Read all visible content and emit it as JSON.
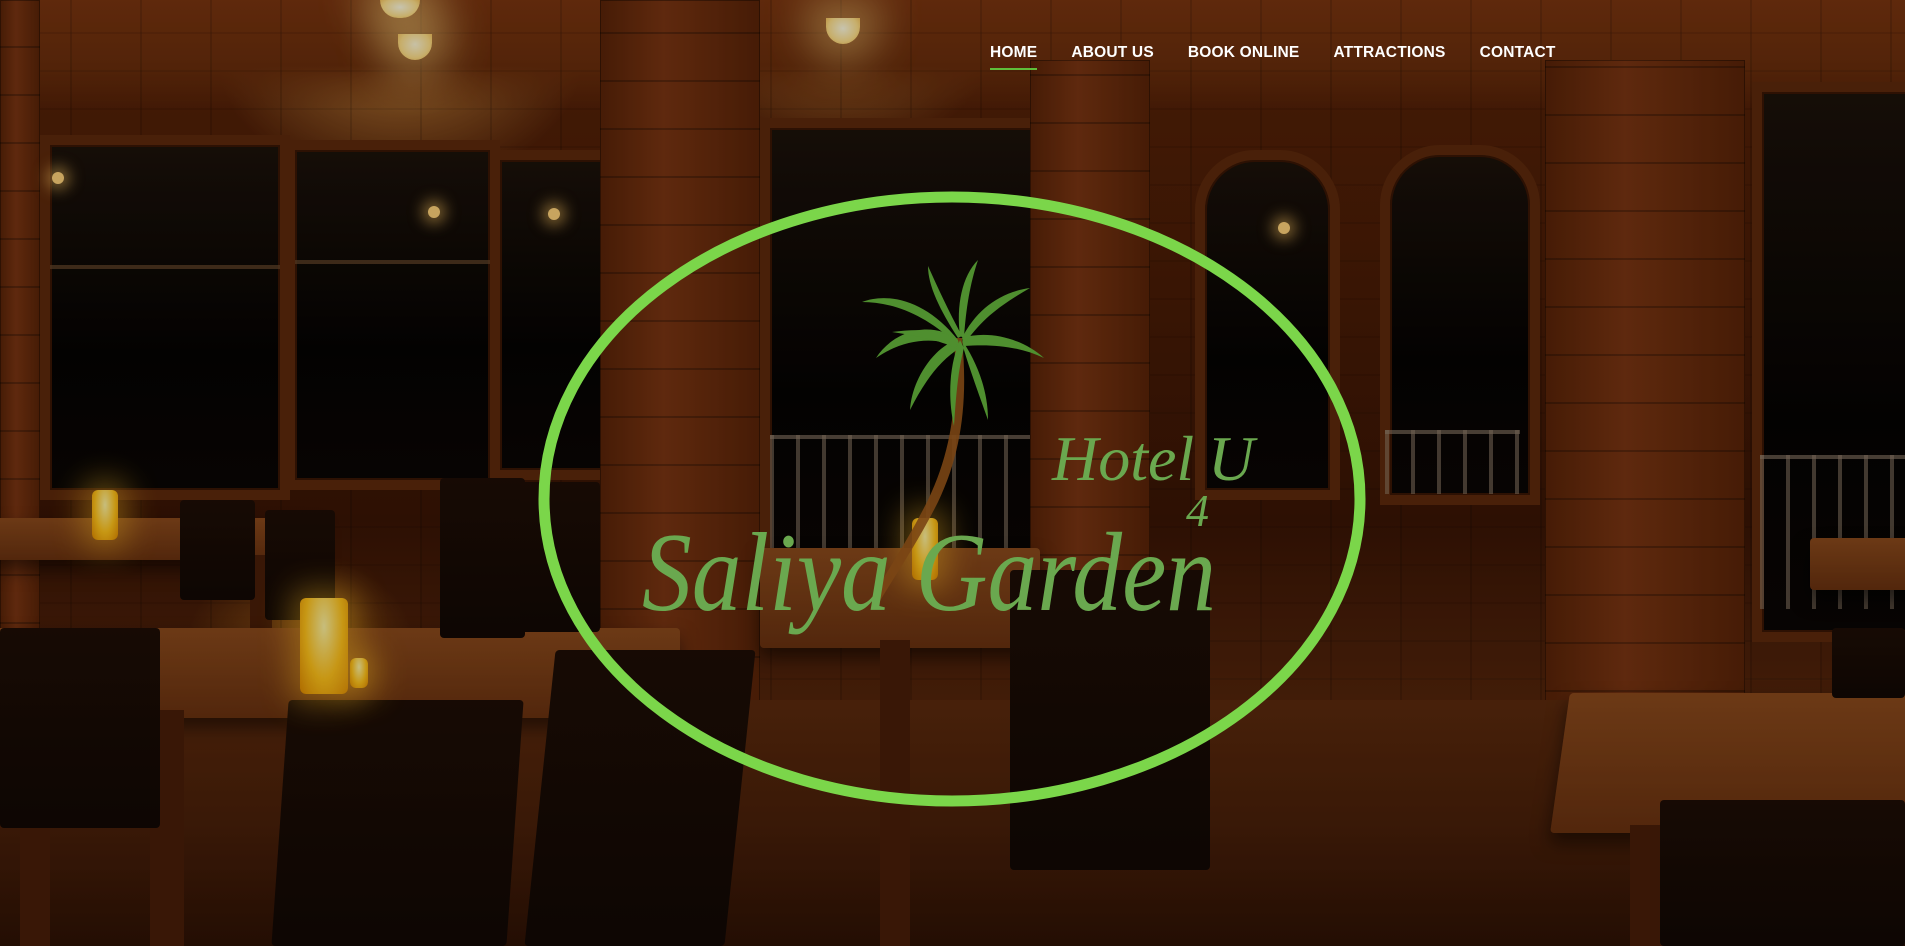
{
  "nav": {
    "items": [
      {
        "label": "HOME",
        "active": true
      },
      {
        "label": "ABOUT US",
        "active": false
      },
      {
        "label": "BOOK ONLINE",
        "active": false
      },
      {
        "label": "ATTRACTIONS",
        "active": false
      },
      {
        "label": "CONTACT",
        "active": false
      }
    ],
    "active_underline_color": "#5fbf3a"
  },
  "logo": {
    "hotel_text": "Hotel",
    "sub_text": "4",
    "u_text": "U",
    "name": "Saliya Garden",
    "ellipse_color": "#7bd64a",
    "text_color": "#6aa84f",
    "palm_color": "#4f8f2f",
    "icon": "palm-tree-icon"
  }
}
